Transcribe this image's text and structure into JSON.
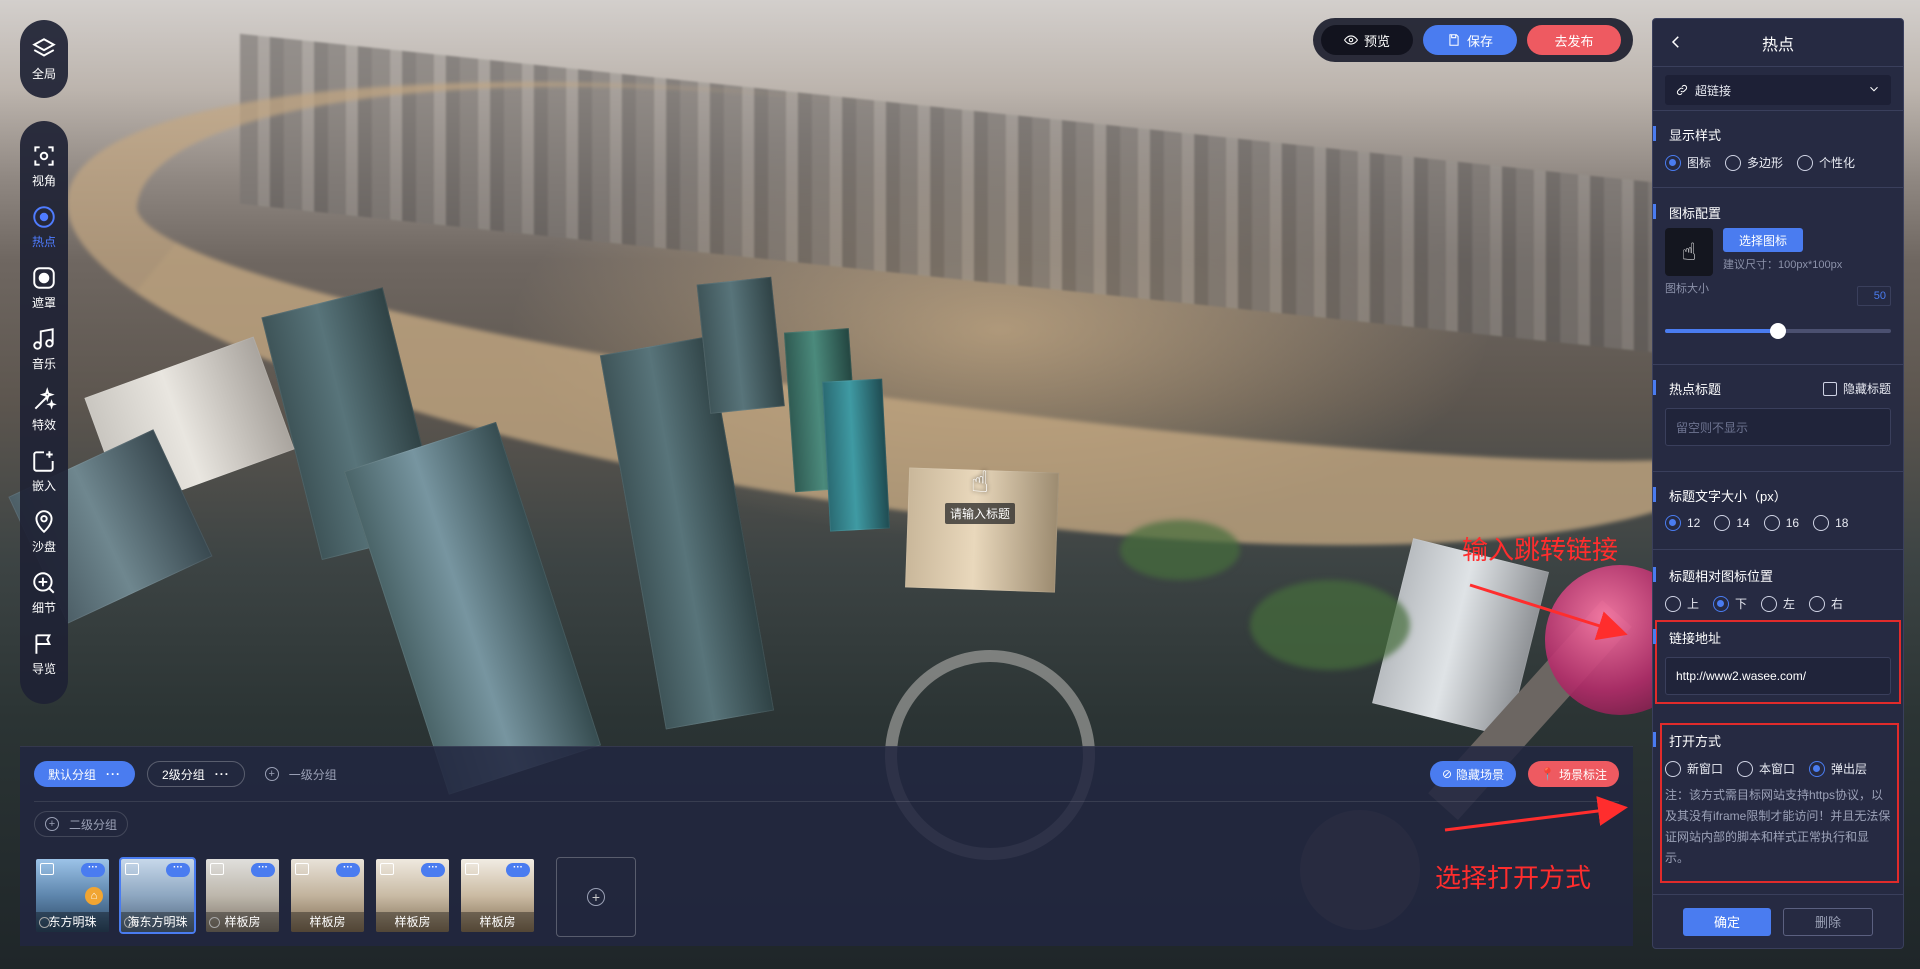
{
  "toolbar_left": {
    "top": {
      "label": "全局",
      "icon": "layers-icon"
    },
    "tools": [
      {
        "key": "view",
        "label": "视角",
        "icon": "target-icon"
      },
      {
        "key": "hotspot",
        "label": "热点",
        "icon": "hotspot-icon",
        "active": true
      },
      {
        "key": "mask",
        "label": "遮罩",
        "icon": "mask-icon"
      },
      {
        "key": "music",
        "label": "音乐",
        "icon": "music-icon"
      },
      {
        "key": "effects",
        "label": "特效",
        "icon": "effects-icon"
      },
      {
        "key": "embed",
        "label": "嵌入",
        "icon": "embed-icon"
      },
      {
        "key": "sandtable",
        "label": "沙盘",
        "icon": "map-pin-icon"
      },
      {
        "key": "detail",
        "label": "细节",
        "icon": "zoom-in-icon"
      },
      {
        "key": "guide",
        "label": "导览",
        "icon": "flag-icon"
      }
    ]
  },
  "topbar": {
    "preview": "预览",
    "save": "保存",
    "publish": "去发布"
  },
  "hotspot_marker": {
    "label": "请输入标题"
  },
  "scene_strip": {
    "groups": {
      "default": "默认分组",
      "level2": "2级分组",
      "add_level1": "一级分组",
      "add_level2": "二级分组"
    },
    "hide_scene": "隐藏场景",
    "scene_mark": "场景标注",
    "thumbs": [
      {
        "name": "东方明珠",
        "home": true,
        "selected": false
      },
      {
        "name": "海东方明珠",
        "home": false,
        "selected": true
      },
      {
        "name": "样板房",
        "home": false,
        "selected": false
      },
      {
        "name": "样板房",
        "home": false,
        "selected": false
      },
      {
        "name": "样板房",
        "home": false,
        "selected": false
      },
      {
        "name": "样板房",
        "home": false,
        "selected": false
      }
    ]
  },
  "panel": {
    "title": "热点",
    "type_select": "超链接",
    "display_style": {
      "title": "显示样式",
      "options": [
        "图标",
        "多边形",
        "个性化"
      ],
      "selected": 0
    },
    "icon_config": {
      "title": "图标配置",
      "choose_button": "选择图标",
      "hint": "建议尺寸：100px*100px",
      "size_label": "图标大小",
      "size_value": "50",
      "size_min": 0,
      "size_max": 100
    },
    "hotspot_title": {
      "title": "热点标题",
      "hide_label": "隐藏标题",
      "placeholder": "留空则不显示"
    },
    "font_size": {
      "title": "标题文字大小（px）",
      "options": [
        "12",
        "14",
        "16",
        "18"
      ],
      "selected": 0
    },
    "position": {
      "title": "标题相对图标位置",
      "options": [
        "上",
        "下",
        "左",
        "右"
      ],
      "selected": 1
    },
    "link": {
      "title": "链接地址",
      "value": "http://www2.wasee.com/"
    },
    "open_mode": {
      "title": "打开方式",
      "options": [
        "新窗口",
        "本窗口",
        "弹出层"
      ],
      "selected": 2,
      "note": "注：该方式需目标网站支持https协议，以及其没有iframe限制才能访问！并且无法保证网站内部的脚本和样式正常执行和显示。"
    },
    "confirm": "确定",
    "delete": "删除"
  },
  "annotations": {
    "link_hint": "输入跳转链接",
    "open_hint": "选择打开方式",
    "color": "#ff2d2d"
  }
}
